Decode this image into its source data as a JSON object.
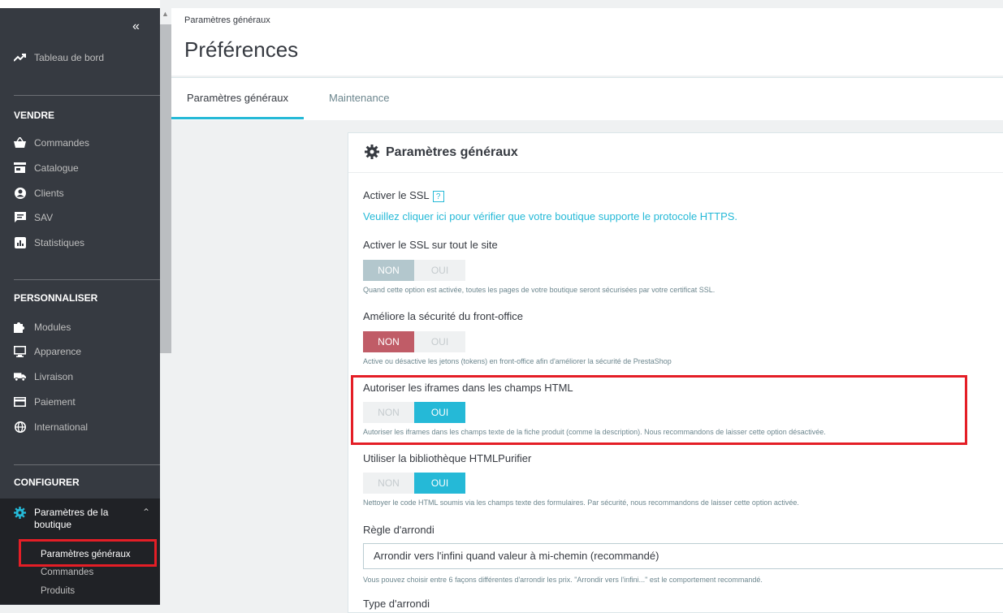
{
  "sidebar": {
    "collapse_icon": "«",
    "dashboard": "Tableau de bord",
    "sections": {
      "sell": "VENDRE",
      "customize": "PERSONNALISER",
      "configure": "CONFIGURER"
    },
    "sell_items": [
      "Commandes",
      "Catalogue",
      "Clients",
      "SAV",
      "Statistiques"
    ],
    "customize_items": [
      "Modules",
      "Apparence",
      "Livraison",
      "Paiement",
      "International"
    ],
    "shop_params": "Paramètres de la boutique",
    "shop_params_line1": "Paramètres de la",
    "shop_params_line2": "boutique",
    "sub_items": [
      "Paramètres généraux",
      "Commandes",
      "Produits"
    ]
  },
  "header": {
    "breadcrumb": "Paramètres généraux",
    "title": "Préférences"
  },
  "tabs": [
    {
      "label": "Paramètres généraux",
      "active": true
    },
    {
      "label": "Maintenance",
      "active": false
    }
  ],
  "panel": {
    "title": "Paramètres généraux",
    "ssl_label": "Activer le SSL",
    "ssl_help": "?",
    "ssl_link": "Veuillez cliquer ici pour vérifier que votre boutique supporte le protocole HTTPS.",
    "fields": [
      {
        "label": "Activer le SSL sur tout le site",
        "no": "NON",
        "yes": "OUI",
        "value": "NON",
        "hint": "Quand cette option est activée, toutes les pages de votre boutique seront sécurisées par votre certificat SSL."
      },
      {
        "label": "Améliore la sécurité du front-office",
        "no": "NON",
        "yes": "OUI",
        "value": "NON",
        "hint": "Active ou désactive les jetons (tokens) en front-office afin d'améliorer la sécurité de PrestaShop"
      },
      {
        "label": "Autoriser les iframes dans les champs HTML",
        "no": "NON",
        "yes": "OUI",
        "value": "OUI",
        "hint": "Autoriser les iframes dans les champs texte de la fiche produit (comme la description). Nous recommandons de laisser cette option désactivée."
      },
      {
        "label": "Utiliser la bibliothèque HTMLPurifier",
        "no": "NON",
        "yes": "OUI",
        "value": "OUI",
        "hint": "Nettoyer le code HTML soumis via les champs texte des formulaires. Par sécurité, nous recommandons de laisser cette option activée."
      }
    ],
    "rounding_label": "Règle d'arrondi",
    "rounding_value": "Arrondir vers l'infini quand valeur à mi-chemin (recommandé)",
    "rounding_hint": "Vous pouvez choisir entre 6 façons différentes d'arrondir les prix. \"Arrondir vers l'infini...\" est le comportement recommandé.",
    "rounding_type_label": "Type d'arrondi"
  },
  "colors": {
    "sidebar_bg": "#363a41",
    "accent": "#25b9d7",
    "danger": "#c05c67",
    "highlight": "#e41e26"
  }
}
